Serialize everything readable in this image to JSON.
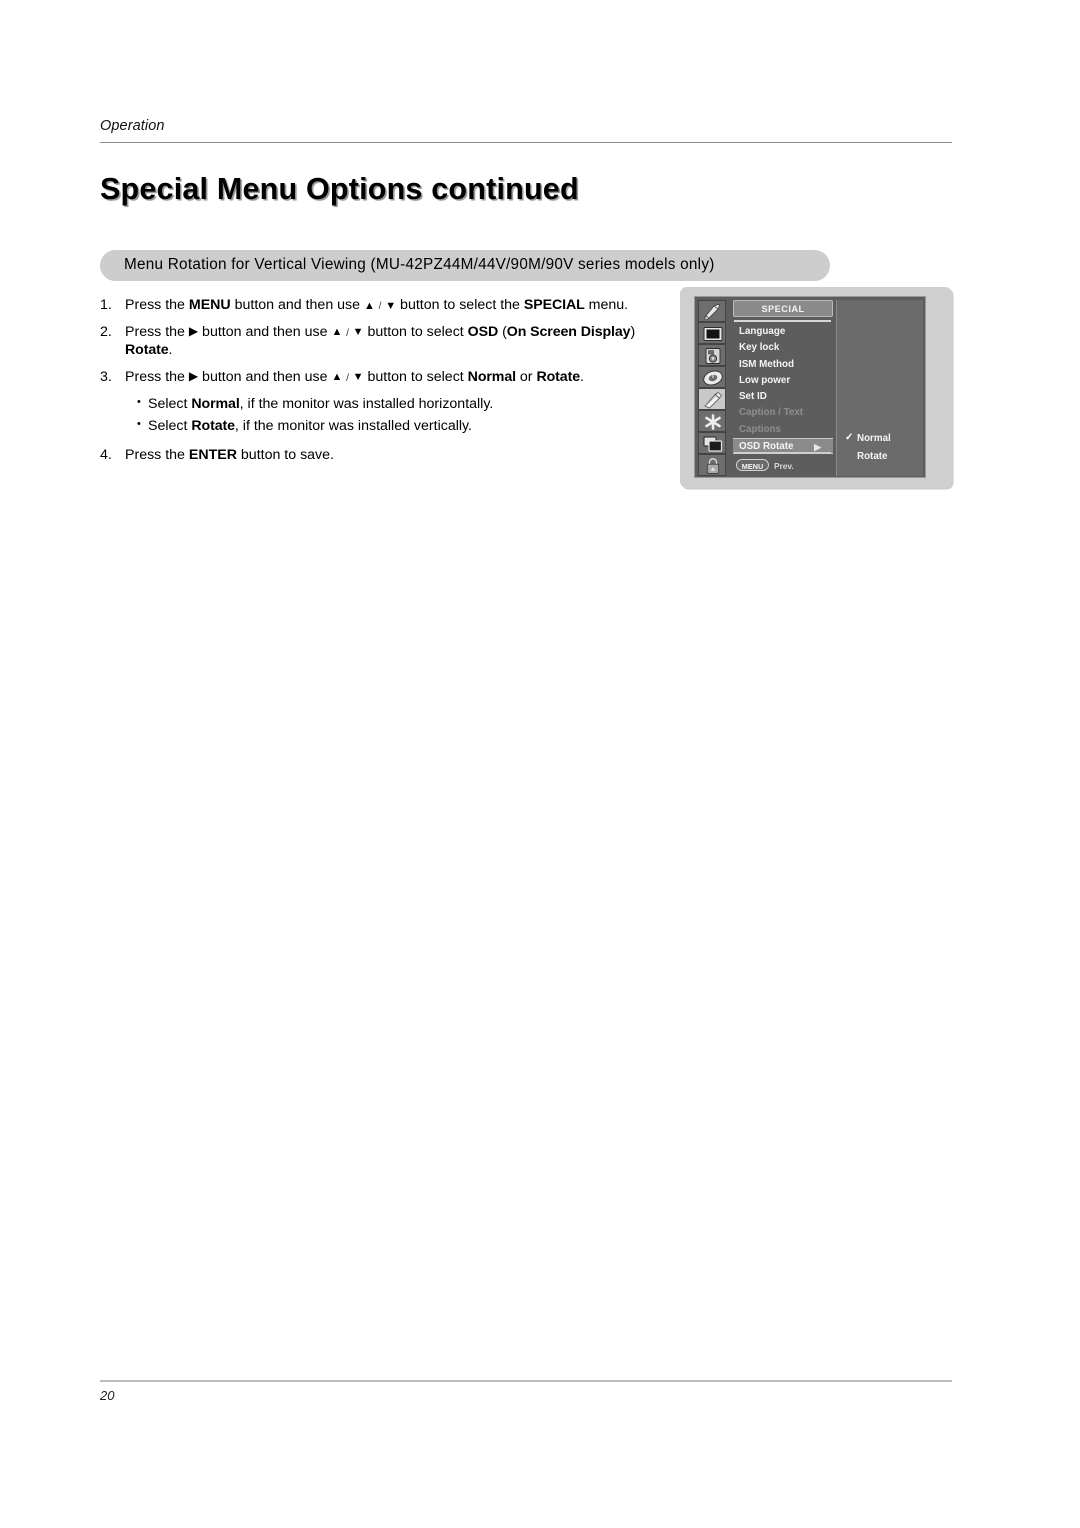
{
  "document": {
    "running_head": "Operation",
    "page_title": "Special Menu Options continued",
    "page_number": "20",
    "section_heading": "Menu Rotation for Vertical Viewing (MU-42PZ44M/44V/90M/90V series models only)"
  },
  "steps": [
    {
      "number": "1.",
      "segments": [
        {
          "t": "Press the ",
          "s": "plain"
        },
        {
          "t": "MENU",
          "s": "bold"
        },
        {
          "t": " button and then use ",
          "s": "plain"
        },
        {
          "t": "▲",
          "s": "tri"
        },
        {
          "t": " / ",
          "s": "slash"
        },
        {
          "t": "▼",
          "s": "tri"
        },
        {
          "t": " button to select the ",
          "s": "plain"
        },
        {
          "t": "SPECIAL",
          "s": "bserif"
        },
        {
          "t": " menu.",
          "s": "plain"
        }
      ]
    },
    {
      "number": "2.",
      "segments": [
        {
          "t": "Press the ",
          "s": "plain"
        },
        {
          "t": "▶",
          "s": "tri-r"
        },
        {
          "t": " button and then use ",
          "s": "plain"
        },
        {
          "t": "▲",
          "s": "tri"
        },
        {
          "t": " / ",
          "s": "slash"
        },
        {
          "t": "▼",
          "s": "tri"
        },
        {
          "t": " button to select ",
          "s": "plain"
        },
        {
          "t": "OSD",
          "s": "bserif"
        },
        {
          "t": " (",
          "s": "plain"
        },
        {
          "t": "On Screen Display",
          "s": "bserif"
        },
        {
          "t": ")",
          "s": "plain"
        }
      ],
      "continuation": [
        {
          "t": "Rotate",
          "s": "bserif"
        },
        {
          "t": ".",
          "s": "plain"
        }
      ]
    },
    {
      "number": "3.",
      "segments": [
        {
          "t": "Press the ",
          "s": "plain"
        },
        {
          "t": "▶",
          "s": "tri-r"
        },
        {
          "t": " button and then use ",
          "s": "plain"
        },
        {
          "t": "▲",
          "s": "tri"
        },
        {
          "t": " / ",
          "s": "slash"
        },
        {
          "t": "▼",
          "s": "tri"
        },
        {
          "t": " button to select ",
          "s": "plain"
        },
        {
          "t": "Normal",
          "s": "bserif"
        },
        {
          "t": " or ",
          "s": "plain"
        },
        {
          "t": "Rotate",
          "s": "bserif"
        },
        {
          "t": ".",
          "s": "plain"
        }
      ]
    }
  ],
  "bullets": [
    [
      {
        "t": "Select ",
        "s": "plain"
      },
      {
        "t": "Normal",
        "s": "bserif"
      },
      {
        "t": ", if the monitor was installed horizontally.",
        "s": "plain"
      }
    ],
    [
      {
        "t": "Select ",
        "s": "plain"
      },
      {
        "t": "Rotate",
        "s": "bserif"
      },
      {
        "t": ", if the monitor was installed vertically.",
        "s": "plain"
      }
    ]
  ],
  "final_step": {
    "number": "4.",
    "segments": [
      {
        "t": "Press the ",
        "s": "plain"
      },
      {
        "t": "ENTER",
        "s": "bold"
      },
      {
        "t": " button to save.",
        "s": "plain"
      }
    ]
  },
  "osd": {
    "title": "SPECIAL",
    "icons": [
      {
        "name": "antenna-icon",
        "selected": false
      },
      {
        "name": "picture-screen-icon",
        "selected": false
      },
      {
        "name": "speaker-audio-icon",
        "selected": false
      },
      {
        "name": "clock-time-icon",
        "selected": false
      },
      {
        "name": "special-wrench-icon",
        "selected": true
      },
      {
        "name": "screen-adjust-icon",
        "selected": false
      },
      {
        "name": "pip-windows-icon",
        "selected": false
      },
      {
        "name": "lock-padlock-icon",
        "selected": false
      }
    ],
    "menu_items": [
      {
        "label": "Language",
        "state": "normal",
        "arrow": ""
      },
      {
        "label": "Key lock",
        "state": "normal",
        "arrow": ""
      },
      {
        "label": "ISM Method",
        "state": "normal",
        "arrow": ""
      },
      {
        "label": "Low power",
        "state": "normal",
        "arrow": ""
      },
      {
        "label": "Set ID",
        "state": "normal",
        "arrow": ""
      },
      {
        "label": "Caption / Text",
        "state": "disabled",
        "arrow": ""
      },
      {
        "label": "Captions",
        "state": "disabled",
        "arrow": ""
      },
      {
        "label": "OSD Rotate",
        "state": "highlighted",
        "arrow": "▶"
      }
    ],
    "footer": {
      "button_label": "MENU",
      "action_label": "Prev."
    },
    "sub_options": [
      {
        "label": "Normal",
        "checked": true,
        "check_glyph": "✓"
      },
      {
        "label": "Rotate",
        "checked": false,
        "check_glyph": ""
      }
    ]
  },
  "colors": {
    "subtitle_bar_bg": "#cdcdcd",
    "osd_frame_bg": "#cfcfcf",
    "osd_screen_bg": "#5d5d5d",
    "osd_highlight": "#8b8b8b",
    "osd_text": "#f5f5f5",
    "osd_text_disabled": "#8e8e8e",
    "rule": "#8d8d8d"
  }
}
